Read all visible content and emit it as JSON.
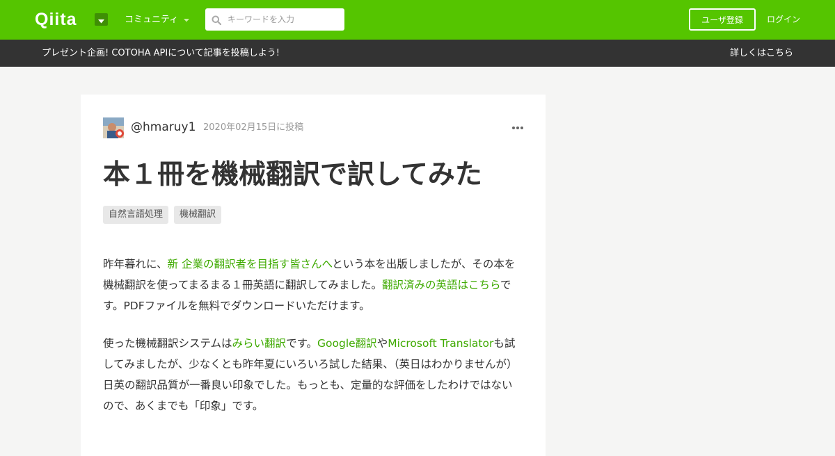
{
  "header": {
    "logo_text": "Qiita",
    "community_label": "コミュニティ",
    "search": {
      "placeholder": "キーワードを入力"
    },
    "signup_label": "ユーザ登録",
    "login_label": "ログイン",
    "brand_color": "#55c500"
  },
  "announcement": {
    "text": "プレゼント企画! COTOHA APIについて記事を投稿しよう!",
    "link": "詳しくはこちら"
  },
  "article": {
    "author": "@hmaruy1",
    "posted_date": "2020年02月15日に投稿",
    "title": "本１冊を機械翻訳で訳してみた",
    "tags": [
      "自然言語処理",
      "機械翻訳"
    ],
    "paragraphs": [
      [
        {
          "text": "昨年暮れに、"
        },
        {
          "text": "新 企業の翻訳者を目指す皆さんへ",
          "link": true
        },
        {
          "text": "という本を出版しましたが、その本を機械翻訳を使ってまるまる１冊英語に翻訳してみました。"
        },
        {
          "text": "翻訳済みの英語はこちら",
          "link": true
        },
        {
          "text": "です。PDFファイルを無料でダウンロードいただけます。"
        }
      ],
      [
        {
          "text": "使った機械翻訳システムは"
        },
        {
          "text": "みらい翻訳",
          "link": true
        },
        {
          "text": "です。"
        },
        {
          "text": "Google翻訳",
          "link": true
        },
        {
          "text": "や"
        },
        {
          "text": "Microsoft Translator",
          "link": true
        },
        {
          "text": "も試してみましたが、少なくとも昨年夏にいろいろ試した結果、（英日はわかりませんが）日英の翻訳品質が一番良い印象でした。もっとも、定量的な評価をしたわけではないので、あくまでも「印象」です。"
        }
      ]
    ],
    "link_color": "#3eaa00"
  }
}
